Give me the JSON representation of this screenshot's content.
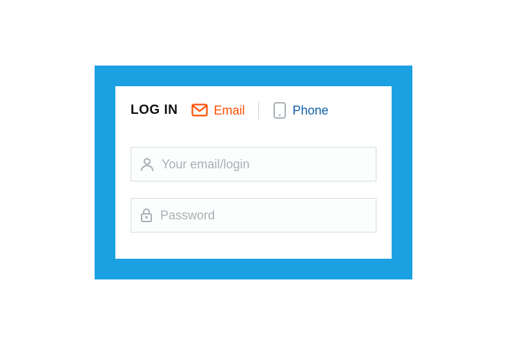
{
  "header": {
    "title": "LOG IN",
    "tabs": {
      "email": "Email",
      "phone": "Phone"
    }
  },
  "fields": {
    "login_placeholder": "Your email/login",
    "login_value": "",
    "password_placeholder": "Password",
    "password_value": ""
  },
  "colors": {
    "frame": "#1ba1e2",
    "accent_active": "#ff4d00",
    "accent_inactive": "#0d5ea6",
    "placeholder": "#a7b0b5",
    "border": "#d7dde0"
  }
}
